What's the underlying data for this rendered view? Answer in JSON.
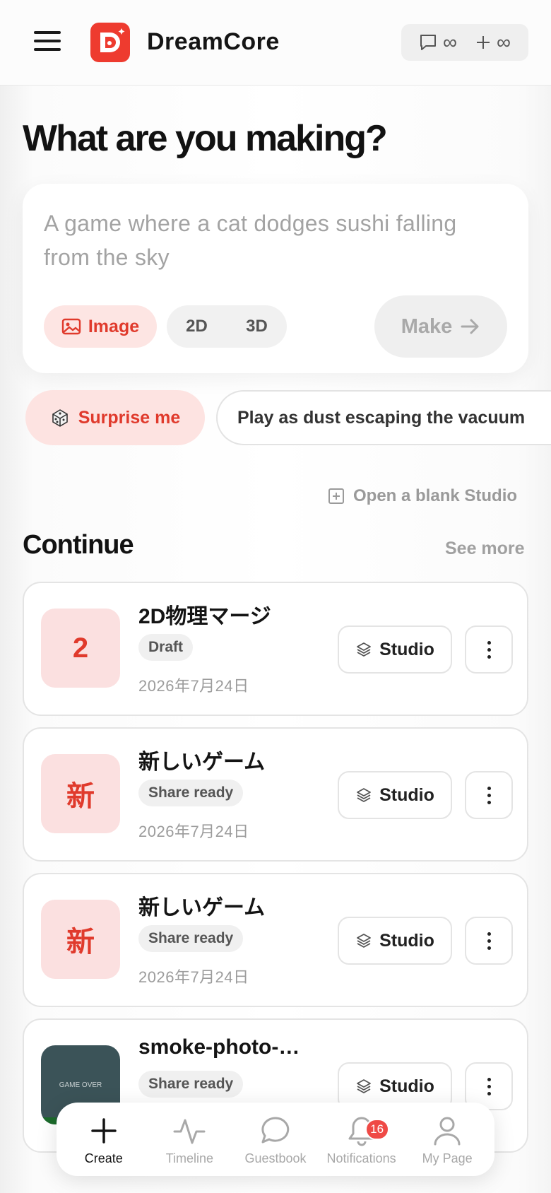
{
  "header": {
    "app_title": "DreamCore",
    "credits": [
      {
        "icon": "chat-bubble-icon",
        "value": "∞"
      },
      {
        "icon": "plus-icon",
        "value": "∞"
      }
    ]
  },
  "hero": {
    "heading": "What are you making?",
    "prompt_placeholder": "A game where a cat dodges sushi falling from the sky",
    "image_label": "Image",
    "dim_2d": "2D",
    "dim_3d": "3D",
    "make_label": "Make"
  },
  "suggestions": {
    "surprise_label": "Surprise me",
    "first_suggestion": "Play as dust escaping the vacuum"
  },
  "blank_studio_label": "Open a blank Studio",
  "continue": {
    "title": "Continue",
    "see_more": "See more",
    "studio_label": "Studio",
    "projects": [
      {
        "thumb": "2",
        "name": "2D物理マージ",
        "status": "Draft",
        "date": "2026年7月24日"
      },
      {
        "thumb": "新",
        "name": "新しいゲーム",
        "status": "Share ready",
        "date": "2026年7月24日"
      },
      {
        "thumb": "新",
        "name": "新しいゲーム",
        "status": "Share ready",
        "date": "2026年7月24日"
      },
      {
        "thumb": "GAME OVER",
        "name": "smoke-photo-…",
        "status": "Share ready",
        "date": ""
      }
    ]
  },
  "nav": {
    "items": [
      {
        "label": "Create",
        "icon": "plus-icon"
      },
      {
        "label": "Timeline",
        "icon": "activity-icon"
      },
      {
        "label": "Guestbook",
        "icon": "chat-bubble-icon"
      },
      {
        "label": "Notifications",
        "icon": "bell-icon",
        "badge": "16"
      },
      {
        "label": "My Page",
        "icon": "user-icon"
      }
    ]
  },
  "colors": {
    "accent": "#ee3b2f",
    "accent_soft": "#fde5e3"
  }
}
